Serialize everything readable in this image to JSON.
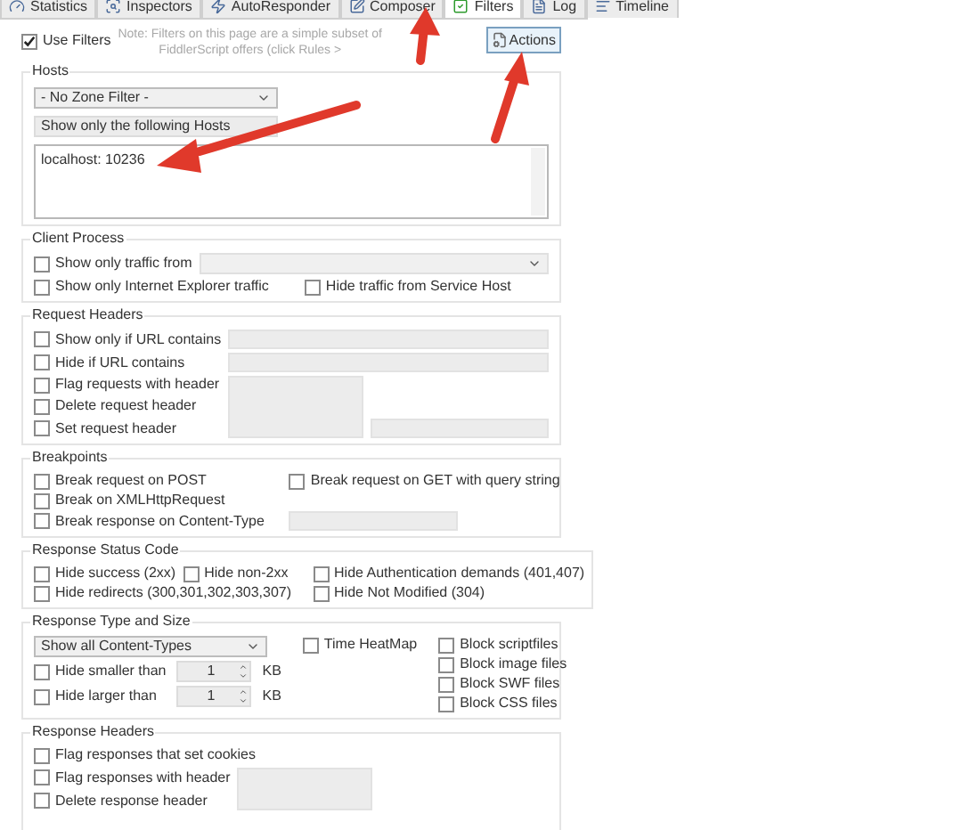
{
  "tabs": [
    {
      "label": "Statistics",
      "kind": "gauge",
      "selected": false
    },
    {
      "label": "Inspectors",
      "kind": "inspect",
      "selected": false
    },
    {
      "label": "AutoResponder",
      "kind": "bolt",
      "selected": false
    },
    {
      "label": "Composer",
      "kind": "pen",
      "selected": false
    },
    {
      "label": "Filters",
      "kind": "check",
      "selected": true
    },
    {
      "label": "Log",
      "kind": "doc",
      "selected": false
    },
    {
      "label": "Timeline",
      "kind": "lines",
      "selected": false
    }
  ],
  "use_filters": {
    "label": "Use Filters",
    "checked": true
  },
  "note": [
    "Note: Filters on this page are a simple subset of",
    "FiddlerScript offers (click Rules >"
  ],
  "actions_button": "Actions",
  "hosts": {
    "title": "Hosts",
    "zone_filter": "- No Zone Filter -",
    "host_filter": "Show only the following Hosts",
    "hosts_list": "localhost: 10236"
  },
  "client_process": {
    "title": "Client Process",
    "show_only_from": {
      "label": "Show only traffic from",
      "checked": false
    },
    "ie_only": {
      "label": "Show only Internet Explorer traffic",
      "checked": false
    },
    "hide_service_host": {
      "label": "Hide traffic from Service Host",
      "checked": false
    }
  },
  "request_headers": {
    "title": "Request Headers",
    "options": [
      {
        "label": "Show only if URL contains",
        "checked": false
      },
      {
        "label": "Hide if URL contains",
        "checked": false
      },
      {
        "label": "Flag requests with header",
        "checked": false
      },
      {
        "label": "Delete request header",
        "checked": false
      },
      {
        "label": "Set request header",
        "checked": false
      }
    ]
  },
  "breakpoints": {
    "title": "Breakpoints",
    "options": [
      {
        "label": "Break request on POST",
        "checked": false
      },
      {
        "label": "Break request on GET with query string",
        "checked": false
      },
      {
        "label": "Break on XMLHttpRequest",
        "checked": false
      },
      {
        "label": "Break response on Content-Type",
        "checked": false
      }
    ]
  },
  "response_status": {
    "title": "Response Status Code",
    "options": [
      {
        "label": "Hide success (2xx)",
        "checked": false
      },
      {
        "label": "Hide non-2xx",
        "checked": false
      },
      {
        "label": "Hide Authentication demands (401,407)",
        "checked": false
      },
      {
        "label": "Hide redirects (300,301,302,303,307)",
        "checked": false
      },
      {
        "label": "Hide Not Modified (304)",
        "checked": false
      }
    ]
  },
  "response_type": {
    "title": "Response Type and Size",
    "content_types": "Show all Content-Types",
    "size_filters": [
      {
        "label": "Hide smaller than",
        "checked": false,
        "value": "1",
        "unit": "KB"
      },
      {
        "label": "Hide larger than",
        "checked": false,
        "value": "1",
        "unit": "KB"
      }
    ],
    "time_heatmap": {
      "label": "Time HeatMap",
      "checked": false
    },
    "block": [
      {
        "label": "Block scriptfiles",
        "checked": false
      },
      {
        "label": "Block image files",
        "checked": false
      },
      {
        "label": "Block SWF files",
        "checked": false
      },
      {
        "label": "Block CSS files",
        "checked": false
      }
    ]
  },
  "response_headers": {
    "title": "Response Headers",
    "options": [
      {
        "label": "Flag responses that set cookies",
        "checked": false
      },
      {
        "label": "Flag responses with header",
        "checked": false
      },
      {
        "label": "Delete response header",
        "checked": false
      }
    ]
  }
}
